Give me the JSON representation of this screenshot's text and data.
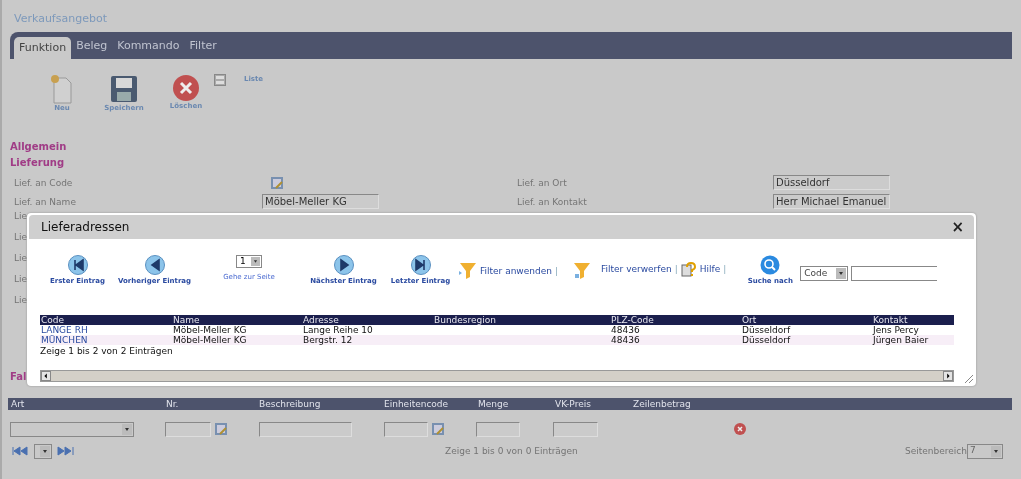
{
  "page": {
    "title": "Verkaufsangebot"
  },
  "tabs": [
    {
      "label": "Funktion",
      "selected": true
    },
    {
      "label": "Beleg",
      "selected": false
    },
    {
      "label": "Kommando",
      "selected": false
    },
    {
      "label": "Filter",
      "selected": false
    }
  ],
  "toolbar": [
    {
      "kind": "new",
      "label": "Neu"
    },
    {
      "kind": "save",
      "label": "Speichern"
    },
    {
      "kind": "delete",
      "label": "Löschen"
    },
    {
      "kind": "list",
      "label": "Liste"
    }
  ],
  "sections": [
    "Allgemein",
    "Lieferung"
  ],
  "fields_left": [
    {
      "label": "Lief. an Code",
      "kind": "lookup"
    },
    {
      "label": "Lief. an Name",
      "kind": "text",
      "value": "Möbel-Meller KG"
    }
  ],
  "fields_right": [
    {
      "label": "Lief. an Ort",
      "value": "Düsseldorf"
    },
    {
      "label": "Lief. an Kontakt",
      "value": "Herr Michael Emanuel"
    }
  ],
  "covered_labels": [
    "Lie",
    "Lie",
    "Lie",
    "Lie",
    "Lie"
  ],
  "covered_section": "Fal",
  "lines": {
    "columns": [
      "Art",
      "Nr.",
      "Beschreibung",
      "Einheitencode",
      "Menge",
      "VK-Preis",
      "Zeilenbetrag"
    ],
    "status": "Zeige 1 bis 0 von 0 Einträgen",
    "range_label": "Seitenbereich",
    "range_value": "7"
  },
  "dialog": {
    "title": "Lieferadressen",
    "close": "×",
    "nav": [
      {
        "kind": "first",
        "label": "Erster Eintrag"
      },
      {
        "kind": "prev",
        "label": "Vorheriger Eintrag"
      },
      {
        "kind": "page",
        "label": "Gehe zur Seite",
        "value": "1"
      },
      {
        "kind": "next",
        "label": "Nächster Eintrag"
      },
      {
        "kind": "last",
        "label": "Letzter Eintrag"
      }
    ],
    "filter_apply": "Filter anwenden",
    "filter_discard": "Filter verwerfen",
    "separator": "|",
    "help": "Hilfe",
    "search_label": "Suche nach",
    "search_field": "Code",
    "columns": [
      "Code",
      "Name",
      "Adresse",
      "Bundesregion",
      "PLZ-Code",
      "Ort",
      "Kontakt"
    ],
    "rows": [
      [
        "LANGE RH",
        "Möbel-Meller KG",
        "Lange Reihe 10",
        "",
        "48436",
        "Düsseldorf",
        "Jens Percy"
      ],
      [
        "MÜNCHEN",
        "Möbel-Meller KG",
        "Bergstr. 12",
        "",
        "48436",
        "Düsseldorf",
        "Jürgen Baier"
      ]
    ],
    "status": "Zeige 1 bis 2 von 2 Einträgen"
  }
}
